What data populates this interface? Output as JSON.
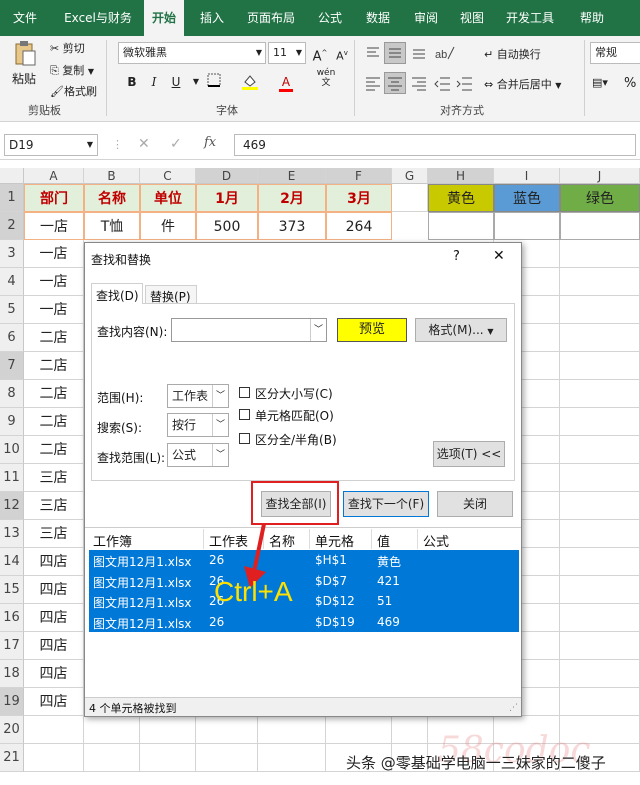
{
  "ribbon_tabs": [
    "文件",
    "Excel与财务",
    "开始",
    "插入",
    "页面布局",
    "公式",
    "数据",
    "审阅",
    "视图",
    "开发工具",
    "帮助"
  ],
  "ribbon": {
    "paste": "粘贴",
    "cut": "剪切",
    "copy": "复制",
    "format_painter": "格式刷",
    "clipboard_group": "剪贴板",
    "font_name": "微软雅黑",
    "font_size": "11",
    "bold": "B",
    "italic": "I",
    "underline": "U",
    "font_color_letter": "A",
    "phonetic": "wén",
    "font_group": "字体",
    "wrap_text": "自动换行",
    "merge_center": "合并后居中",
    "align_group": "对齐方式",
    "number_format": "常规",
    "percent": "%"
  },
  "formula_bar": {
    "name_box": "D19",
    "fx": "fx",
    "value": "469"
  },
  "columns": [
    "A",
    "B",
    "C",
    "D",
    "E",
    "F",
    "G",
    "H",
    "I",
    "J"
  ],
  "rows": [
    "1",
    "2",
    "3",
    "4",
    "5",
    "6",
    "7",
    "8",
    "9",
    "10",
    "11",
    "12",
    "13",
    "14",
    "15",
    "16",
    "17",
    "18",
    "19",
    "20",
    "21"
  ],
  "sheet": {
    "header": [
      "部门",
      "名称",
      "单位",
      "1月",
      "2月",
      "3月"
    ],
    "row2": [
      "一店",
      "T恤",
      "件",
      "500",
      "373",
      "264"
    ],
    "colors": [
      "黄色",
      "蓝色",
      "绿色"
    ],
    "col_a": [
      "一店",
      "一店",
      "一店",
      "二店",
      "二店",
      "二店",
      "二店",
      "二店",
      "三店",
      "三店",
      "三店",
      "四店",
      "四店",
      "四店",
      "四店",
      "四店",
      "四店"
    ]
  },
  "colors": {
    "excel_green": "#217346",
    "header_fill": "#e2efda",
    "header_text": "#c00000",
    "yellow_fill": "#c9c900",
    "blue_fill": "#5b9bd5",
    "green_fill": "#70ad47",
    "selection_blue": "#0078d7",
    "preview_yellow": "#ffff00",
    "callout_red": "#e02020"
  },
  "dialog": {
    "title": "查找和替换",
    "help": "?",
    "close_icon": "✕",
    "tab_find": "查找(D)",
    "tab_replace": "替换(P)",
    "find_label": "查找内容(N):",
    "find_value": "",
    "preview": "预览",
    "format_btn": "格式(M)...",
    "scope_label": "范围(H):",
    "scope_value": "工作表",
    "search_label": "搜索(S):",
    "search_value": "按行",
    "lookin_label": "查找范围(L):",
    "lookin_value": "公式",
    "match_case": "区分大小写(C)",
    "match_cell": "单元格匹配(O)",
    "match_width": "区分全/半角(B)",
    "options_btn": "选项(T) <<",
    "find_all": "查找全部(I)",
    "find_next": "查找下一个(F)",
    "close_btn": "关闭",
    "result_headers": [
      "工作簿",
      "工作表",
      "名称",
      "单元格",
      "值",
      "公式"
    ],
    "results": [
      [
        "图文用12月1.xlsx",
        "26",
        "",
        "$H$1",
        "黄色",
        ""
      ],
      [
        "图文用12月1.xlsx",
        "26",
        "",
        "$D$7",
        "421",
        ""
      ],
      [
        "图文用12月1.xlsx",
        "26",
        "",
        "$D$12",
        "51",
        ""
      ],
      [
        "图文用12月1.xlsx",
        "26",
        "",
        "$D$19",
        "469",
        ""
      ]
    ],
    "status": "4 个单元格被找到"
  },
  "annotation": "Ctrl+A",
  "watermark": "头条 @零基础学电脑一三妹家的二傻子",
  "watermark_bg": "58codoc"
}
